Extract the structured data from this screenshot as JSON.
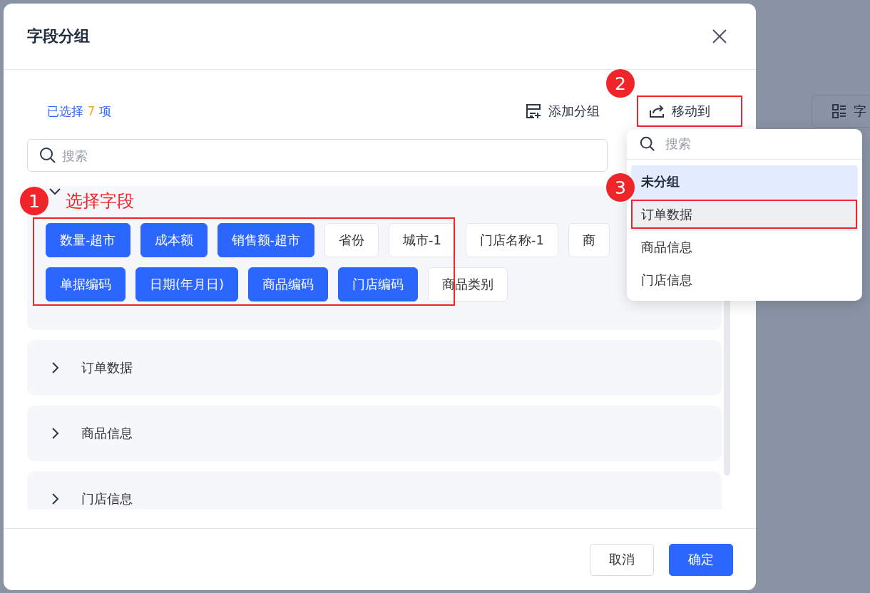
{
  "background": {
    "button_label": "字"
  },
  "dialog": {
    "title": "字段分组",
    "selection": {
      "prefix": "已选择",
      "count": "7",
      "suffix": "项"
    },
    "toolbar": {
      "add_group": "添加分组",
      "move_to": "移动到"
    },
    "search": {
      "placeholder": "搜索"
    },
    "groups": [
      {
        "expanded": true,
        "rows": [
          [
            {
              "label": "数量-超市",
              "selected": true
            },
            {
              "label": "成本额",
              "selected": true
            },
            {
              "label": "销售额-超市",
              "selected": true
            },
            {
              "label": "省份",
              "selected": false
            },
            {
              "label": "城市-1",
              "selected": false
            },
            {
              "label": "门店名称-1",
              "selected": false
            },
            {
              "label": "商",
              "selected": false
            }
          ],
          [
            {
              "label": "单据编码",
              "selected": true
            },
            {
              "label": "日期(年月日)",
              "selected": true
            },
            {
              "label": "商品编码",
              "selected": true
            },
            {
              "label": "门店编码",
              "selected": true
            },
            {
              "label": "商品类别",
              "selected": false
            }
          ]
        ]
      },
      {
        "name": "订单数据",
        "expanded": false
      },
      {
        "name": "商品信息",
        "expanded": false
      },
      {
        "name": "门店信息",
        "expanded": false
      }
    ],
    "buttons": {
      "cancel": "取消",
      "ok": "确定"
    }
  },
  "dropdown": {
    "placeholder": "搜索",
    "items": [
      {
        "label": "未分组",
        "selected": true,
        "hovered": false
      },
      {
        "label": "订单数据",
        "selected": false,
        "hovered": true
      },
      {
        "label": "商品信息",
        "selected": false,
        "hovered": false
      },
      {
        "label": "门店信息",
        "selected": false,
        "hovered": false
      }
    ]
  },
  "annotations": [
    {
      "number": "1",
      "label": "选择字段"
    },
    {
      "number": "2"
    },
    {
      "number": "3"
    }
  ]
}
